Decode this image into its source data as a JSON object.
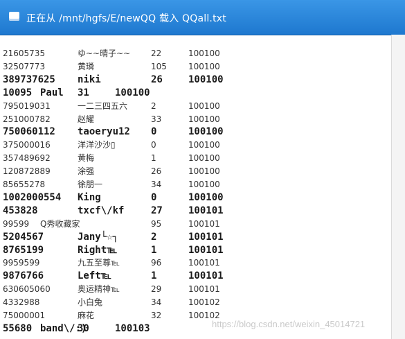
{
  "status_bar": {
    "message": "正在从 /mnt/hgfs/E/newQQ 载入 QQall.txt",
    "icon": "document-icon"
  },
  "colors": {
    "title_bar": "#2a86dc",
    "text": "#333333",
    "background": "#ffffff"
  },
  "records": [
    {
      "qq": "21605735",
      "nickname": "ゆ~~晴子~~",
      "age": "22",
      "code": "100100",
      "style": "norm"
    },
    {
      "qq": "32507773",
      "nickname": "黄璘",
      "age": "105",
      "code": "100100",
      "style": "norm"
    },
    {
      "qq": "389737625",
      "nickname": "niki",
      "age": "26",
      "code": "100100",
      "style": "mono"
    },
    {
      "qq": "10095",
      "nickname": "Paul",
      "age": "31",
      "code": "100100",
      "style": "mono-tight"
    },
    {
      "qq": "795019031",
      "nickname": "一二三四五六",
      "age": "2",
      "code": "100100",
      "style": "norm"
    },
    {
      "qq": "251000782",
      "nickname": "赵耀",
      "age": "33",
      "code": "100100",
      "style": "norm"
    },
    {
      "qq": "750060112",
      "nickname": "taoeryu12",
      "age": "0",
      "code": "100100",
      "style": "mono"
    },
    {
      "qq": "375000016",
      "nickname": "洋洋沙沙▯",
      "age": "0",
      "code": "100100",
      "style": "norm"
    },
    {
      "qq": "357489692",
      "nickname": "黄梅",
      "age": "1",
      "code": "100100",
      "style": "norm"
    },
    {
      "qq": "120872889",
      "nickname": "涂强",
      "age": "26",
      "code": "100100",
      "style": "norm"
    },
    {
      "qq": "85655278",
      "nickname": "徐朋一",
      "age": "34",
      "code": "100100",
      "style": "norm"
    },
    {
      "qq": "1002000554",
      "nickname": "King",
      "age": "0",
      "code": "100100",
      "style": "mono"
    },
    {
      "qq": "453828",
      "nickname": "txcf\\/kf",
      "age": "27",
      "code": "100101",
      "style": "mono"
    },
    {
      "qq": "99599",
      "nickname": "Q秀收藏家",
      "age": "95",
      "code": "100101",
      "style": "mixed"
    },
    {
      "qq": "5204567",
      "nickname": "Jany└☆┐",
      "age": "2",
      "code": "100101",
      "style": "mono"
    },
    {
      "qq": "8765199",
      "nickname": "Right℡",
      "age": "1",
      "code": "100101",
      "style": "mono"
    },
    {
      "qq": "9959599",
      "nickname": "九五至尊℡",
      "age": "96",
      "code": "100101",
      "style": "norm"
    },
    {
      "qq": "9876766",
      "nickname": "Left℡",
      "age": "1",
      "code": "100101",
      "style": "mono"
    },
    {
      "qq": "630605060",
      "nickname": "奥运精神℡",
      "age": "29",
      "code": "100101",
      "style": "norm"
    },
    {
      "qq": "4332988",
      "nickname": "小白兔",
      "age": "34",
      "code": "100102",
      "style": "norm"
    },
    {
      "qq": "75000001",
      "nickname": "麻花",
      "age": "32",
      "code": "100102",
      "style": "norm"
    },
    {
      "qq": "55680",
      "nickname": "band\\/:)",
      "age": "30",
      "code": "100103",
      "style": "mono-tight"
    }
  ],
  "watermark": "https://blog.csdn.net/weixin_45014721"
}
